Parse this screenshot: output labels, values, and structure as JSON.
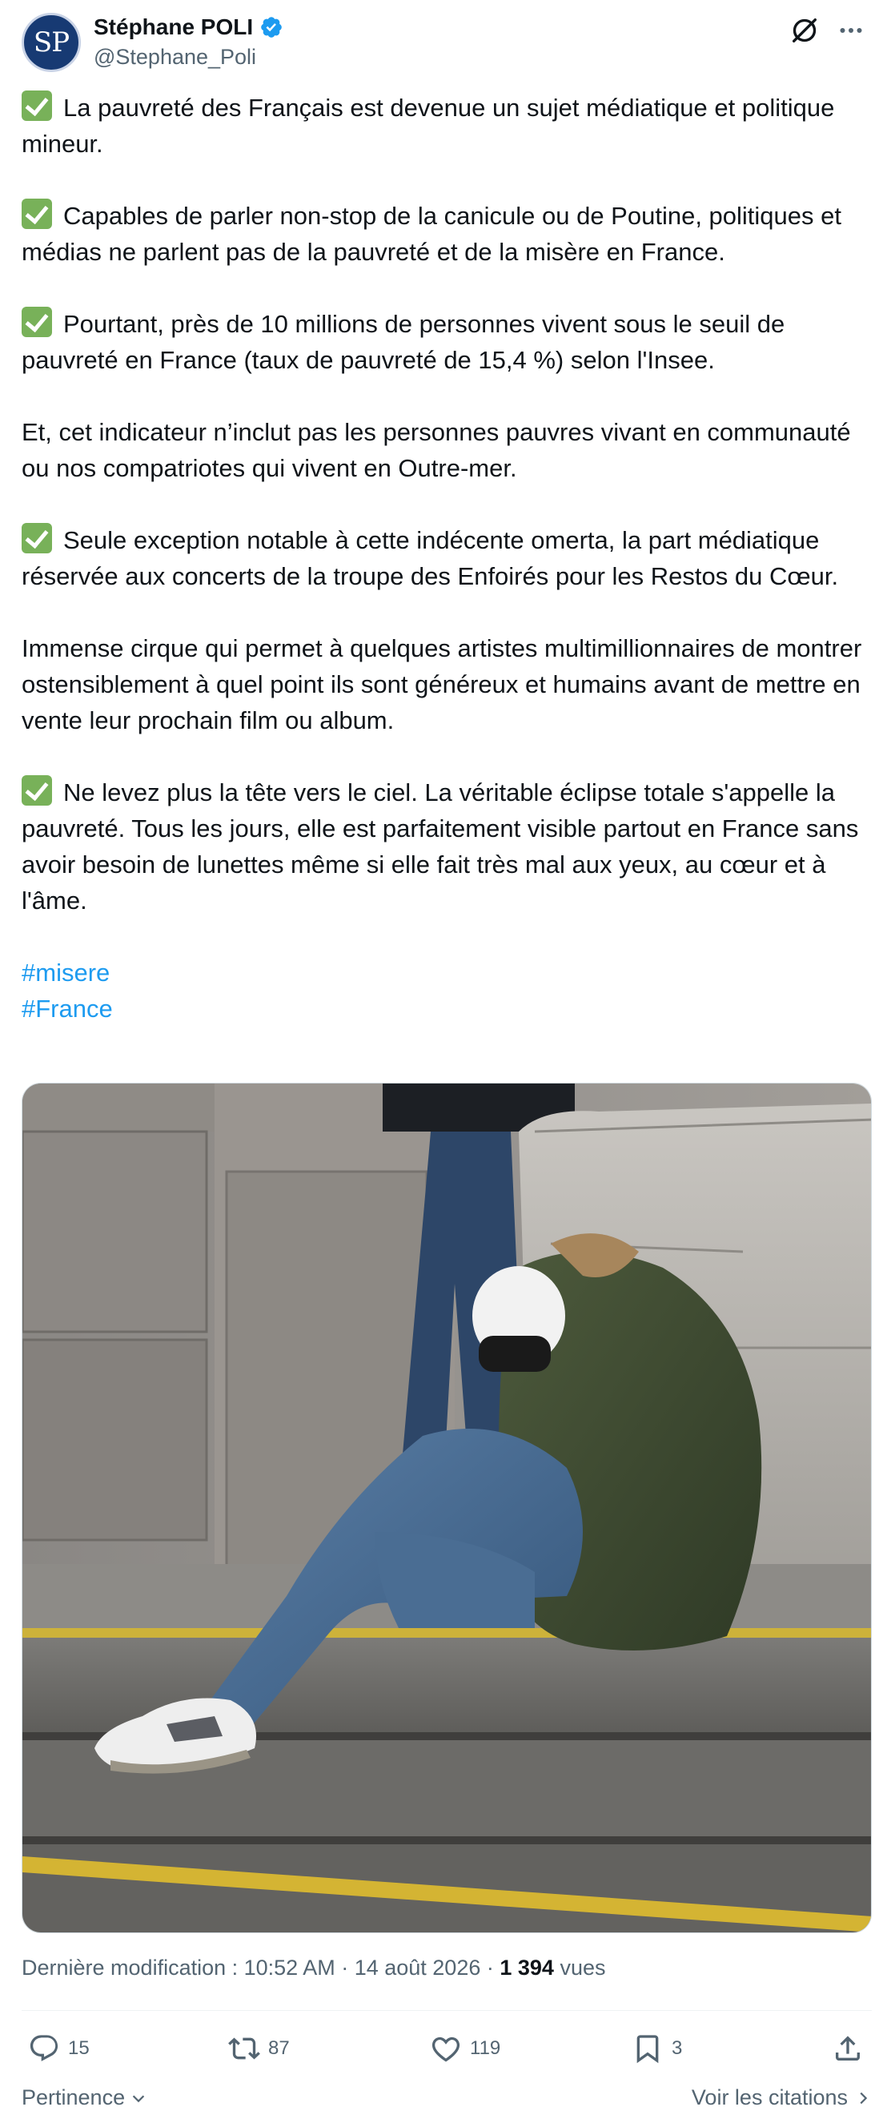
{
  "author": {
    "display_name": "Stéphane POLI",
    "handle": "@Stephane_Poli",
    "avatar_initials": "SP",
    "verified": true
  },
  "tweet": {
    "paragraphs": [
      {
        "check": true,
        "text": "La pauvreté des Français est devenue un sujet médiatique et politique mineur."
      },
      {
        "check": true,
        "text": "Capables de parler non-stop de la canicule ou de Poutine, politiques et médias ne parlent pas de la pauvreté et de la misère en France."
      },
      {
        "check": true,
        "text": "Pourtant, près de 10 millions de personnes vivent sous le seuil de pauvreté en France (taux de pauvreté de 15,4 %) selon l'Insee."
      },
      {
        "check": false,
        "text": "Et, cet indicateur n’inclut pas les personnes pauvres vivant en communauté ou nos compatriotes qui vivent en Outre-mer."
      },
      {
        "check": true,
        "text": "Seule exception notable à cette indécente omerta, la part médiatique réservée aux concerts de la troupe des Enfoirés pour les Restos du Cœur."
      },
      {
        "check": false,
        "text": "Immense cirque qui permet à quelques artistes multimillionnaires de montrer ostensiblement à quel point ils sont généreux et humains avant de mettre en vente leur prochain film ou album."
      },
      {
        "check": true,
        "text": "Ne levez plus la tête vers le ciel. La véritable éclipse totale s'appelle la pauvreté. Tous les jours, elle est parfaitement visible partout en France sans avoir besoin de lunettes même si elle fait très mal aux yeux, au cœur et à l'âme."
      }
    ],
    "hashtags": [
      "#misere",
      "#France"
    ]
  },
  "meta": {
    "prefix": "Dernière modification : ",
    "time": "10:52 AM",
    "separator": " · ",
    "date": "14 août 2026",
    "views_count": "1 394",
    "views_label": "vues"
  },
  "actions": {
    "replies": "15",
    "reposts": "87",
    "likes": "119",
    "bookmarks": "3"
  },
  "footer": {
    "sort_label": "Pertinence",
    "quotes_label": "Voir les citations"
  },
  "colors": {
    "accent": "#1d9bf0",
    "check": "#78b159",
    "muted": "#536471"
  }
}
